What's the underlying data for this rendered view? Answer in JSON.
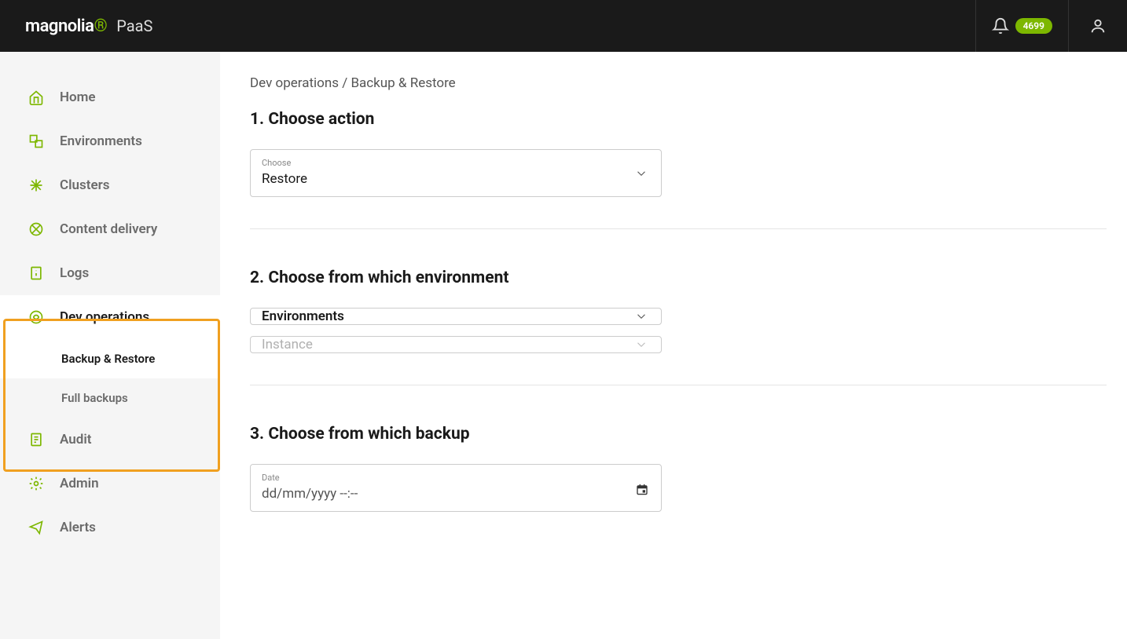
{
  "header": {
    "logo_text": "magnolia",
    "suffix": "PaaS",
    "notification_count": "4699"
  },
  "sidebar": {
    "items": [
      {
        "label": "Home"
      },
      {
        "label": "Environments"
      },
      {
        "label": "Clusters"
      },
      {
        "label": "Content delivery"
      },
      {
        "label": "Logs"
      },
      {
        "label": "Dev operations"
      },
      {
        "label": "Audit"
      },
      {
        "label": "Admin"
      },
      {
        "label": "Alerts"
      }
    ],
    "devops_sub": [
      {
        "label": "Backup & Restore"
      },
      {
        "label": "Full backups"
      }
    ]
  },
  "main": {
    "breadcrumb": "Dev operations / Backup & Restore",
    "section1": {
      "title": "1. Choose action",
      "field_label": "Choose",
      "field_value": "Restore"
    },
    "section2": {
      "title": "2. Choose from which environment",
      "env_placeholder": "Environments",
      "instance_placeholder": "Instance"
    },
    "section3": {
      "title": "3. Choose from which backup",
      "date_label": "Date",
      "date_value": "dd/mm/yyyy --:--"
    }
  }
}
